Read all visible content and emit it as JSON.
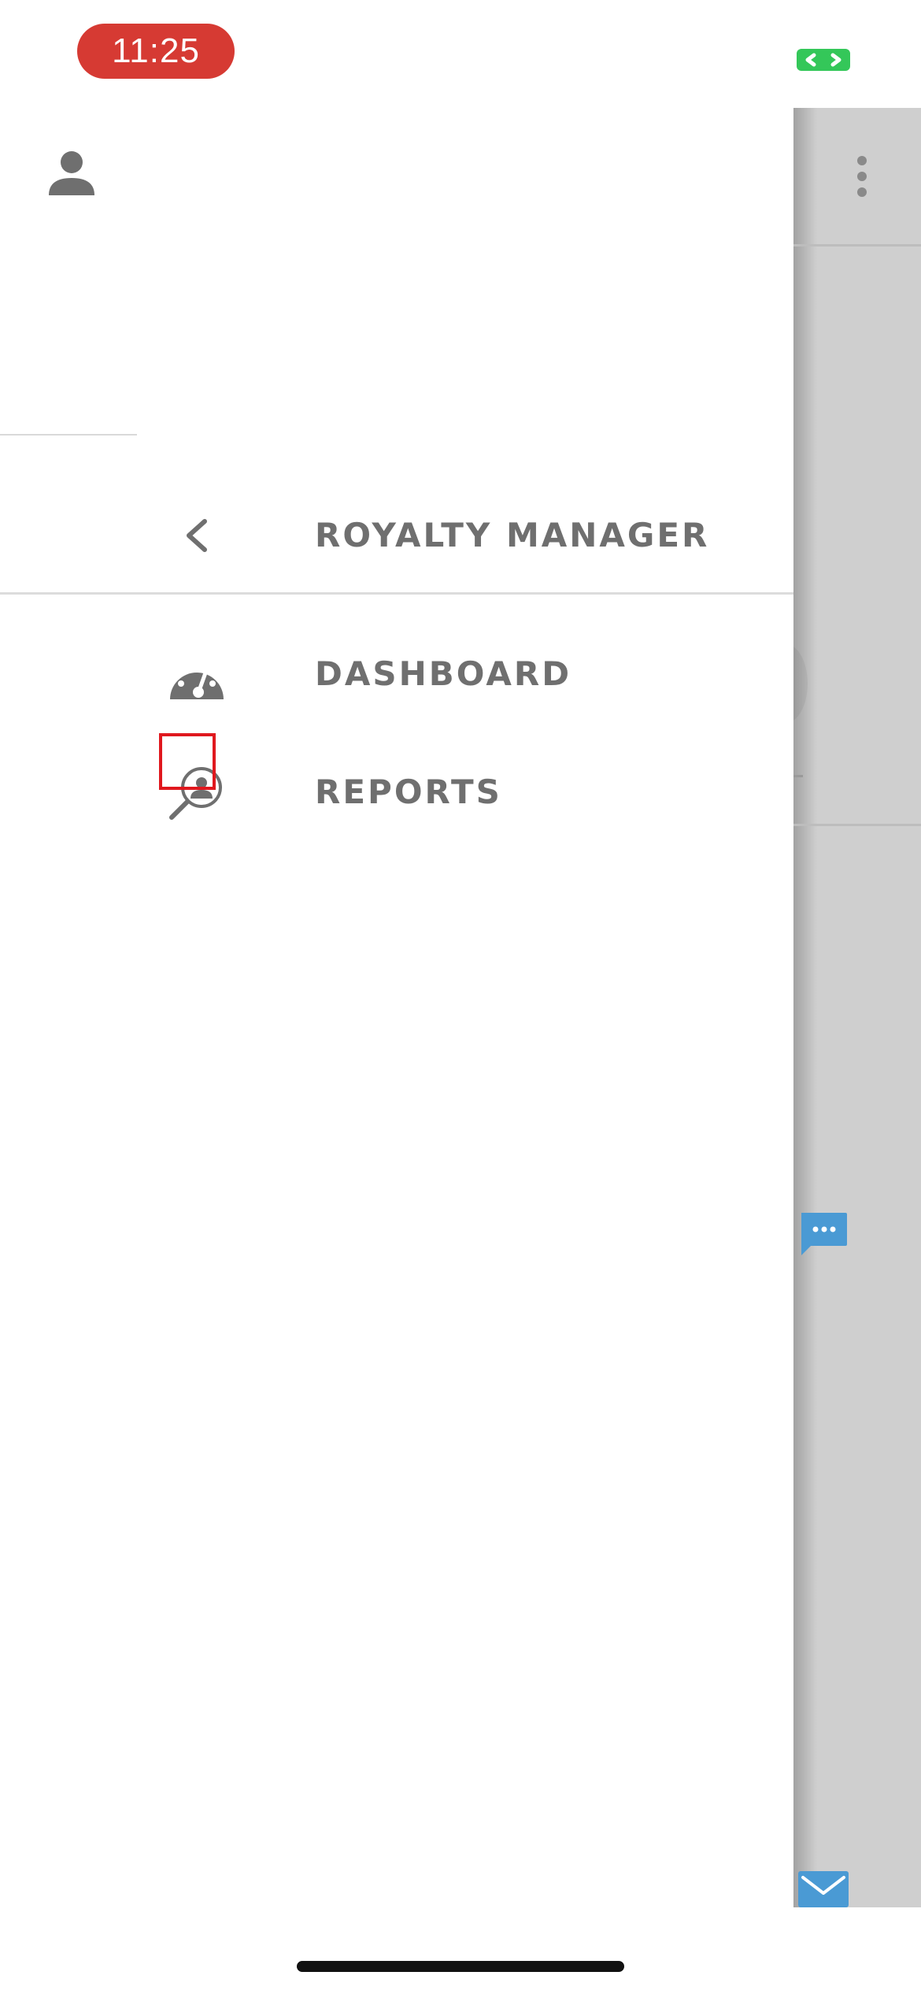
{
  "status_bar": {
    "time": "11:25",
    "sync_icon": "sync-icon",
    "time_color": "#d63a33",
    "sync_color": "#34c759"
  },
  "drawer": {
    "profile_icon": "person-icon",
    "section": {
      "back_icon": "chevron-left-icon",
      "title": "ROYALTY MANAGER"
    },
    "items": [
      {
        "label": "DASHBOARD",
        "icon": "speedometer-icon"
      },
      {
        "label": "REPORTS",
        "icon": "search-user-icon"
      }
    ]
  },
  "background_app": {
    "more_icon": "more-vertical-icon",
    "chat_icon": "chat-icon",
    "mail_icon": "mail-icon",
    "accent_color": "#4a9ad4"
  },
  "colors": {
    "text": "#6f6f6f",
    "divider": "#dcdcdc",
    "highlight": "#e0181e",
    "overlay": "#cfcfcf"
  }
}
